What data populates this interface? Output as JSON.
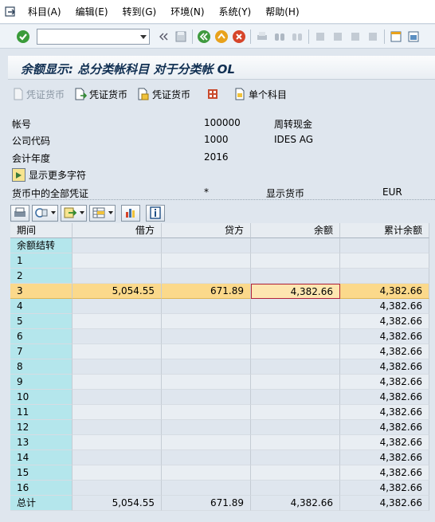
{
  "menu": [
    "科目(A)",
    "编辑(E)",
    "转到(G)",
    "环境(N)",
    "系统(Y)",
    "帮助(H)"
  ],
  "title": "余额显示: 总分类帐科目 对于分类帐 OL",
  "app_toolbar": {
    "btn1": "凭证货币",
    "btn2": "凭证货币",
    "btn3": "凭证货币",
    "btn5": "单个科目"
  },
  "header": {
    "account_label": "帐号",
    "account_value": "100000",
    "account_desc": "周转现金",
    "company_label": "公司代码",
    "company_value": "1000",
    "company_desc": "IDES AG",
    "year_label": "会计年度",
    "year_value": "2016",
    "more_label": "显示更多字符",
    "all_docs_label": "货币中的全部凭证",
    "all_docs_value": "*",
    "display_ccy_label": "显示货币",
    "display_ccy_value": "EUR"
  },
  "grid": {
    "columns": [
      "期间",
      "借方",
      "贷方",
      "余额",
      "累计余额"
    ],
    "rows": [
      [
        "余额结转",
        "",
        "",
        "",
        ""
      ],
      [
        "1",
        "",
        "",
        "",
        ""
      ],
      [
        "2",
        "",
        "",
        "",
        ""
      ],
      [
        "3",
        "5,054.55",
        "671.89",
        "4,382.66",
        "4,382.66"
      ],
      [
        "4",
        "",
        "",
        "",
        "4,382.66"
      ],
      [
        "5",
        "",
        "",
        "",
        "4,382.66"
      ],
      [
        "6",
        "",
        "",
        "",
        "4,382.66"
      ],
      [
        "7",
        "",
        "",
        "",
        "4,382.66"
      ],
      [
        "8",
        "",
        "",
        "",
        "4,382.66"
      ],
      [
        "9",
        "",
        "",
        "",
        "4,382.66"
      ],
      [
        "10",
        "",
        "",
        "",
        "4,382.66"
      ],
      [
        "11",
        "",
        "",
        "",
        "4,382.66"
      ],
      [
        "12",
        "",
        "",
        "",
        "4,382.66"
      ],
      [
        "13",
        "",
        "",
        "",
        "4,382.66"
      ],
      [
        "14",
        "",
        "",
        "",
        "4,382.66"
      ],
      [
        "15",
        "",
        "",
        "",
        "4,382.66"
      ],
      [
        "16",
        "",
        "",
        "",
        "4,382.66"
      ],
      [
        "总计",
        "5,054.55",
        "671.89",
        "4,382.66",
        "4,382.66"
      ]
    ],
    "selected_row": "3"
  }
}
